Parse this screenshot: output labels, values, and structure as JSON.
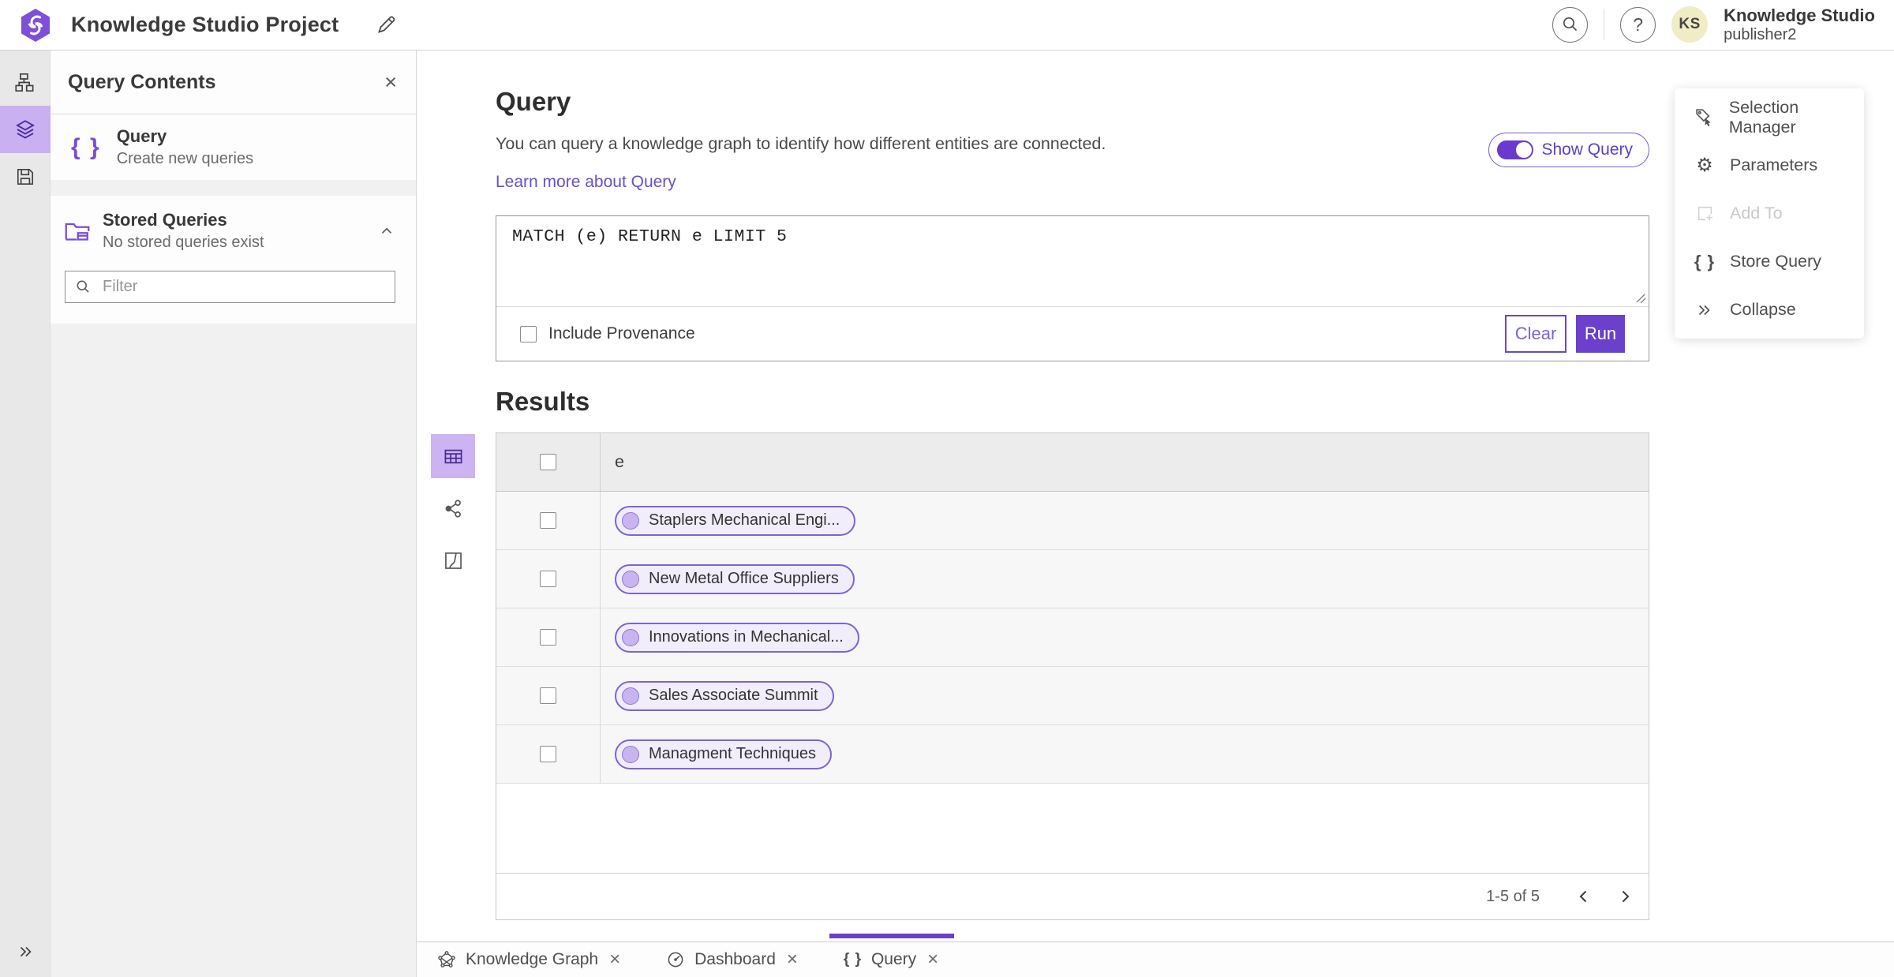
{
  "header": {
    "project_title": "Knowledge Studio Project",
    "help_glyph": "?",
    "account": {
      "initials": "KS",
      "app_name": "Knowledge Studio",
      "user": "publisher2"
    }
  },
  "contents_panel": {
    "title": "Query Contents",
    "close_glyph": "×",
    "query_item": {
      "icon_glyph": "{ }",
      "title": "Query",
      "subtitle": "Create new queries"
    },
    "stored_queries": {
      "title": "Stored Queries",
      "subtitle": "No stored queries exist"
    },
    "filter_placeholder": "Filter"
  },
  "query_section": {
    "heading": "Query",
    "description": "You can query a knowledge graph to identify how different entities are connected.",
    "learn_more": "Learn more about Query",
    "show_query": "Show Query",
    "query_text": "MATCH (e) RETURN e LIMIT 5",
    "include_provenance": "Include Provenance",
    "clear": "Clear",
    "run": "Run"
  },
  "results": {
    "heading": "Results",
    "column": "e",
    "rows": [
      "Staplers Mechanical Engi...",
      "New Metal Office Suppliers",
      "Innovations in Mechanical...",
      "Sales Associate Summit",
      "Managment Techniques"
    ],
    "pagination": "1-5 of 5"
  },
  "tools_panel": {
    "selection_manager": "Selection Manager",
    "parameters": "Parameters",
    "gear_glyph": "⚙",
    "add_to": "Add To",
    "store_query": "Store Query",
    "braces_glyph": "{ }",
    "collapse": "Collapse"
  },
  "tabs": {
    "knowledge_graph": "Knowledge Graph",
    "dashboard": "Dashboard",
    "query": "Query",
    "query_braces": "{ }",
    "close_glyph": "×"
  },
  "colors": {
    "accent": "#6a40cd",
    "accent_light": "#c9b0f1",
    "pill_border": "#7e63d5",
    "pill_bg": "#f1edfb",
    "avatar_bg": "#f0ecc6"
  }
}
